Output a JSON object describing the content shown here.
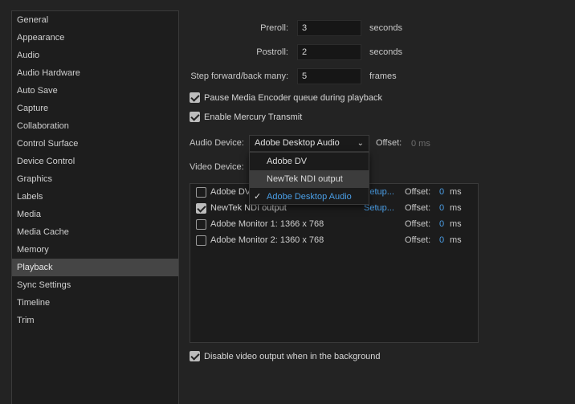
{
  "sidebar": {
    "items": [
      {
        "label": "General"
      },
      {
        "label": "Appearance"
      },
      {
        "label": "Audio"
      },
      {
        "label": "Audio Hardware"
      },
      {
        "label": "Auto Save"
      },
      {
        "label": "Capture"
      },
      {
        "label": "Collaboration"
      },
      {
        "label": "Control Surface"
      },
      {
        "label": "Device Control"
      },
      {
        "label": "Graphics"
      },
      {
        "label": "Labels"
      },
      {
        "label": "Media"
      },
      {
        "label": "Media Cache"
      },
      {
        "label": "Memory"
      },
      {
        "label": "Playback"
      },
      {
        "label": "Sync Settings"
      },
      {
        "label": "Timeline"
      },
      {
        "label": "Trim"
      }
    ],
    "selected": "Playback"
  },
  "preroll": {
    "label": "Preroll:",
    "value": "3",
    "unit": "seconds"
  },
  "postroll": {
    "label": "Postroll:",
    "value": "2",
    "unit": "seconds"
  },
  "step": {
    "label": "Step forward/back many:",
    "value": "5",
    "unit": "frames"
  },
  "pause_encoder": {
    "label": "Pause Media Encoder queue during playback",
    "checked": true
  },
  "mercury": {
    "label": "Enable Mercury Transmit",
    "checked": true
  },
  "audio_device": {
    "label": "Audio Device:",
    "value": "Adobe Desktop Audio",
    "offset_label": "Offset:",
    "offset_value": "0 ms",
    "options": [
      "Adobe DV",
      "NewTek NDI output",
      "Adobe Desktop Audio"
    ],
    "check_mark": "✓",
    "chevron": "⌄"
  },
  "video_device": {
    "label": "Video Device:",
    "rows": [
      {
        "name": "Adobe DV",
        "checked": false,
        "setup": "Setup...",
        "offset_label": "Offset:",
        "offset_value": "0",
        "unit": "ms"
      },
      {
        "name": "NewTek NDI output",
        "checked": true,
        "setup": "Setup...",
        "offset_label": "Offset:",
        "offset_value": "0",
        "unit": "ms"
      },
      {
        "name": "Adobe Monitor 1: 1366 x 768",
        "checked": false,
        "setup": "",
        "offset_label": "Offset:",
        "offset_value": "0",
        "unit": "ms"
      },
      {
        "name": "Adobe Monitor 2: 1360 x 768",
        "checked": false,
        "setup": "",
        "offset_label": "Offset:",
        "offset_value": "0",
        "unit": "ms"
      }
    ]
  },
  "disable_bg": {
    "label": "Disable video output when in the background",
    "checked": true
  },
  "colors": {
    "accent": "#4a9ee6",
    "selection": "#454545",
    "background": "#232323"
  }
}
